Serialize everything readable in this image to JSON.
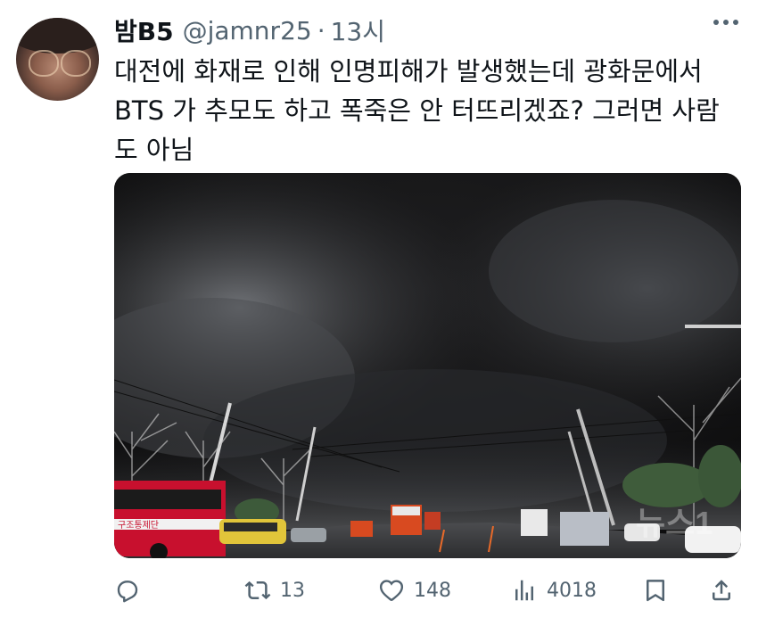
{
  "author": {
    "display_name": "밤B5",
    "handle": "@jamnr25",
    "separator": "·",
    "time": "13시"
  },
  "tweet": {
    "lines": [
      "대전에 화재로 인해 인명피해가 발생했는데 광화문에서",
      "BTS 가 추모도 하고 폭죽은 안 터뜨리겠죠? 그러면 사람",
      "도 아님"
    ]
  },
  "media": {
    "truck_text": "구조통제단",
    "watermark": "뉴스1"
  },
  "actions": {
    "reply_count": "",
    "retweet_count": "13",
    "like_count": "148",
    "view_count": "4018"
  },
  "icons": {
    "reply": "reply-icon",
    "retweet": "retweet-icon",
    "like": "heart-icon",
    "views": "views-icon",
    "bookmark": "bookmark-icon",
    "share": "share-icon",
    "more": "more-icon"
  },
  "colors": {
    "text": "#0f1419",
    "secondary": "#536471",
    "fire_truck_red": "#c8102e"
  }
}
